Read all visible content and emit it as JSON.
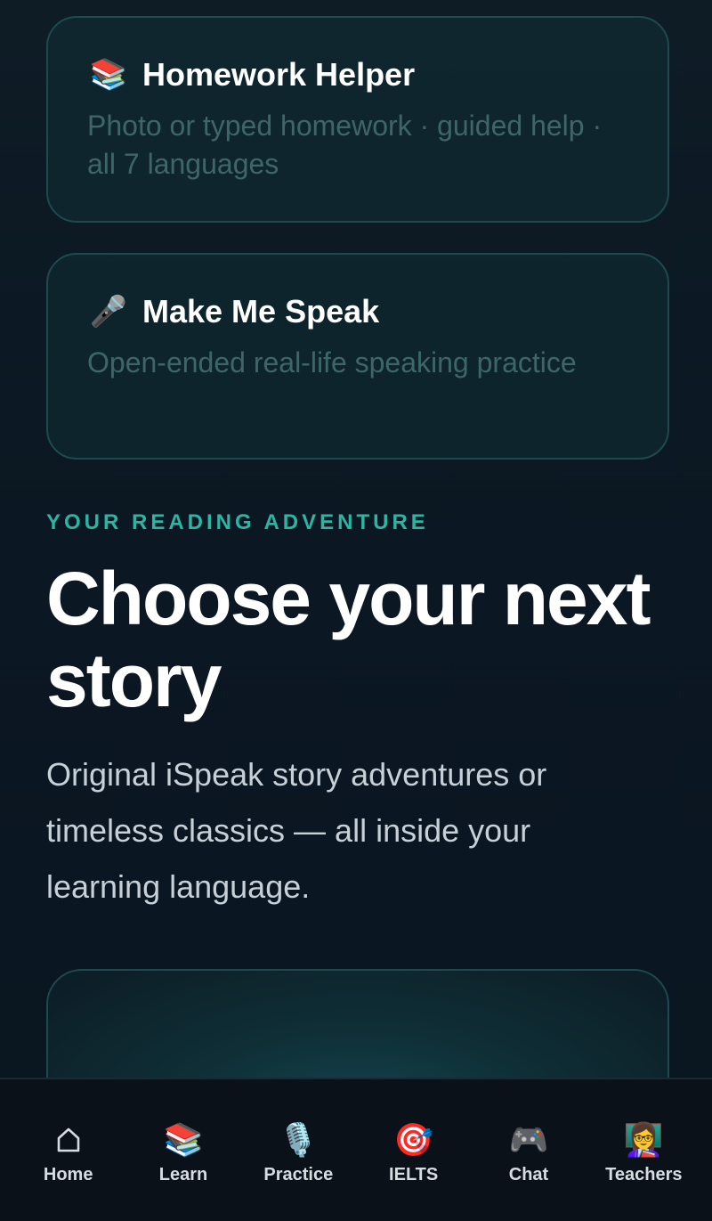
{
  "cards": [
    {
      "icon": "📚",
      "title": "Homework Helper",
      "description": "Photo or typed homework · guided help · all 7 languages"
    },
    {
      "icon": "🎤",
      "title": "Make Me Speak",
      "description": "Open-ended real-life speaking practice"
    }
  ],
  "reading": {
    "eyebrow": "YOUR READING ADVENTURE",
    "title": "Choose your next story",
    "subtitle": "Original iSpeak story adventures or timeless classics — all inside your learning language."
  },
  "nav": {
    "items": [
      {
        "icon": "home-icon",
        "label": "Home"
      },
      {
        "icon": "📚",
        "label": "Learn"
      },
      {
        "icon": "🎙️",
        "label": "Practice"
      },
      {
        "icon": "🎯",
        "label": "IELTS"
      },
      {
        "icon": "🎮",
        "label": "Chat"
      },
      {
        "icon": "👩‍🏫",
        "label": "Teachers"
      }
    ]
  },
  "colors": {
    "accent": "#2bb5a2",
    "background": "#0b1620",
    "card_border": "#1c4a4e"
  }
}
